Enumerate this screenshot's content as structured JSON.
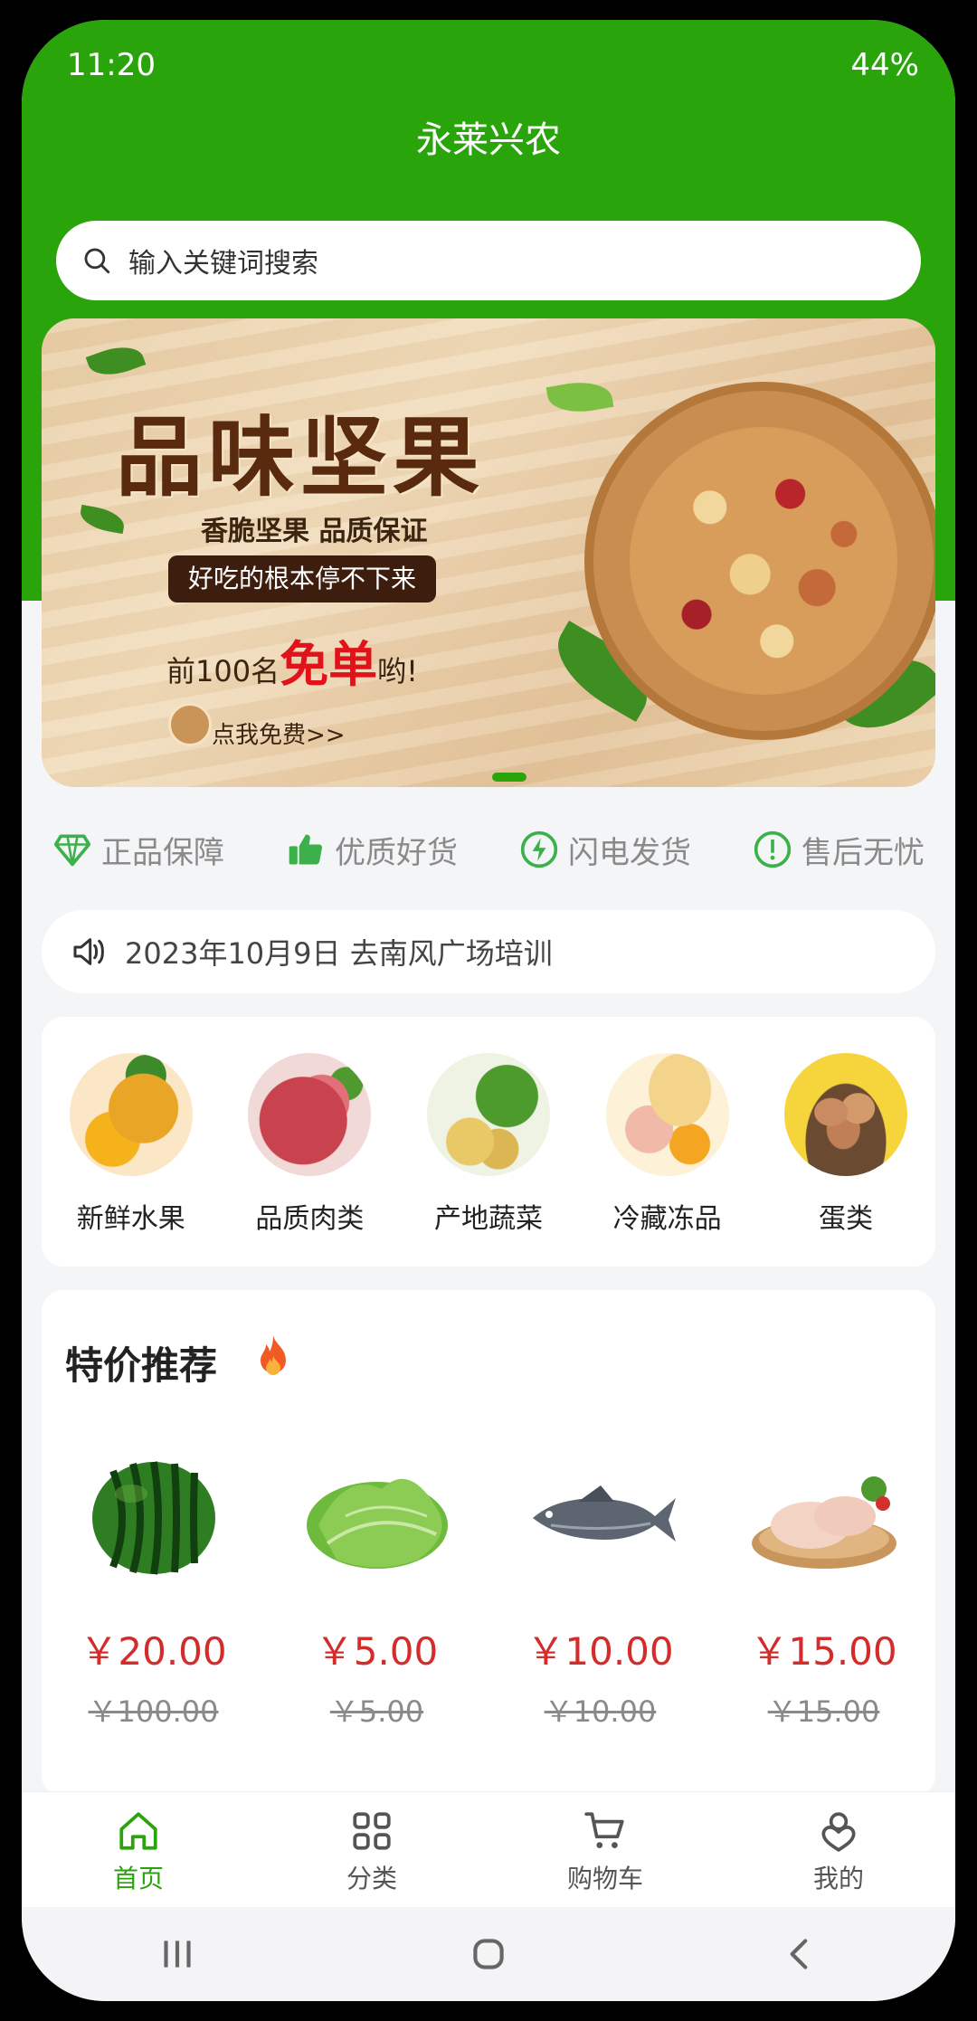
{
  "status_bar": {
    "time": "11:20",
    "battery": "44%"
  },
  "header": {
    "title": "永莱兴农"
  },
  "search": {
    "placeholder": "输入关键词搜索"
  },
  "banner": {
    "title": "品味坚果",
    "subtitle": "香脆坚果 品质保证",
    "pill": "好吃的根本停不下来",
    "promo_prefix": "前100名",
    "promo_highlight": "免单",
    "promo_suffix": "哟!",
    "cta": "点我免费>>",
    "active_slide": 1
  },
  "features": [
    {
      "icon": "diamond-icon",
      "label": "正品保障"
    },
    {
      "icon": "thumbs-up-icon",
      "label": "优质好货"
    },
    {
      "icon": "lightning-icon",
      "label": "闪电发货"
    },
    {
      "icon": "exclamation-icon",
      "label": "售后无忧"
    }
  ],
  "notice": {
    "icon": "speaker-icon",
    "text": "2023年10月9日 去南风广场培训"
  },
  "categories": [
    {
      "label": "新鲜水果"
    },
    {
      "label": "品质肉类"
    },
    {
      "label": "产地蔬菜"
    },
    {
      "label": "冷藏冻品"
    },
    {
      "label": "蛋类"
    }
  ],
  "special": {
    "title": "特价推荐",
    "products": [
      {
        "name_icon": "watermelon",
        "price": "￥20.00",
        "old_price": "￥100.00"
      },
      {
        "name_icon": "lettuce",
        "price": "￥5.00",
        "old_price": "￥5.00"
      },
      {
        "name_icon": "fish",
        "price": "￥10.00",
        "old_price": "￥10.00"
      },
      {
        "name_icon": "chicken",
        "price": "￥15.00",
        "old_price": "￥15.00"
      }
    ]
  },
  "tabs": [
    {
      "label": "首页",
      "active": true
    },
    {
      "label": "分类",
      "active": false
    },
    {
      "label": "购物车",
      "active": false
    },
    {
      "label": "我的",
      "active": false
    }
  ],
  "colors": {
    "brand_green": "#2aa40b",
    "price_red": "#d42b2b"
  }
}
